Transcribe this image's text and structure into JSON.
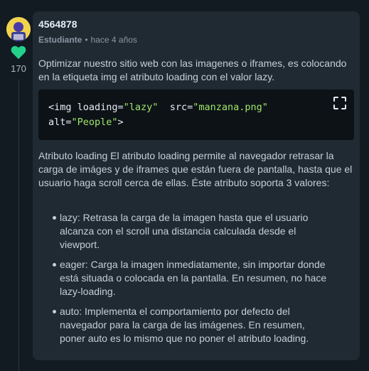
{
  "author": {
    "username": "4564878",
    "role": "Estudiante",
    "separator": "•",
    "time": "hace 4 años",
    "avatar_icon": "student-avatar-icon"
  },
  "votes": {
    "count": "170",
    "icon": "heart-icon",
    "color": "#23d18b"
  },
  "content": {
    "intro": "Optimizar nuestro sitio web con las imagenes o iframes, es colocando en la etiqueta img el atributo loading con el valor lazy.",
    "code": {
      "tag_open": "<img loading=",
      "loading_value": "\"lazy\"",
      "src_attr": "  src=",
      "src_value": "\"manzana.png\"",
      "alt_attr": "alt=",
      "alt_value": "\"People\"",
      "tag_close": ">",
      "expand_icon": "fullscreen-icon"
    },
    "description": "Atributo loading El atributo loading permite al navegador retrasar la carga de imáges y de iframes que están fuera de pantalla, hasta que el usuario haga scroll cerca de ellas. Éste atributo soporta 3 valores:",
    "values": [
      {
        "text": "lazy: Retrasa la carga de la imagen hasta que el usuario alcanza con el scroll una distancia calculada desde el viewport."
      },
      {
        "text": "eager: Carga la imagen inmediatamente, sin importar donde está situada o colocada en la pantalla. En resumen, no hace lazy-loading."
      },
      {
        "text": "auto: Implementa el comportamiento por defecto del navegador para la carga de las imágenes. En resumen, poner auto es lo mismo que no poner el atributo loading."
      }
    ]
  },
  "colors": {
    "background": "#121a22",
    "card": "#1f2a33",
    "code_bg": "#0d1217",
    "string": "#9fe86a",
    "avatar_bg": "#f2d34b"
  }
}
